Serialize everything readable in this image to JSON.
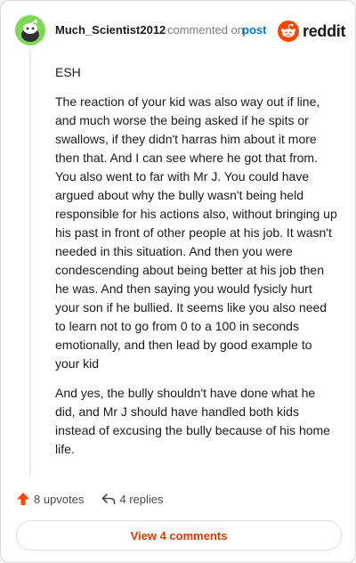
{
  "header": {
    "username": "Much_Scientist2012",
    "commented_text": "commented on",
    "post_link": "post",
    "brand_name": "reddit"
  },
  "comment": {
    "paragraphs": [
      "ESH",
      "The reaction of your kid was also way out if line, and much worse the being asked if he spits or swallows, if they didn't harras him about it more then that. And I can see where he got that from. You also went to far with Mr J. You could have argued about why the bully wasn't being held responsible for his actions also, without bringing up his past in front of other people at his job. It wasn't needed in this situation. And then you were condescending about being better at his job then he was. And then saying you would fysicly hurt your son if he bullied. It seems like you also need to learn not to go from 0 to a 100 in seconds emotionally, and then lead by good example to your kid",
      "And yes, the bully shouldn't have done what he did, and Mr J should have handled both kids instead of excusing the bully because of his home life."
    ]
  },
  "actions": {
    "upvotes": "8 upvotes",
    "replies": "4 replies"
  },
  "view_comments": "View 4 comments",
  "colors": {
    "accent": "#ff4500",
    "link": "#0079d3",
    "view_button_text": "#d93a00",
    "avatar_bg": "#7ed957"
  },
  "icons": {
    "avatar": "snoo-avatar-icon",
    "brand": "reddit-logo-icon",
    "upvote": "upvote-arrow-icon",
    "reply": "reply-arrow-icon"
  }
}
